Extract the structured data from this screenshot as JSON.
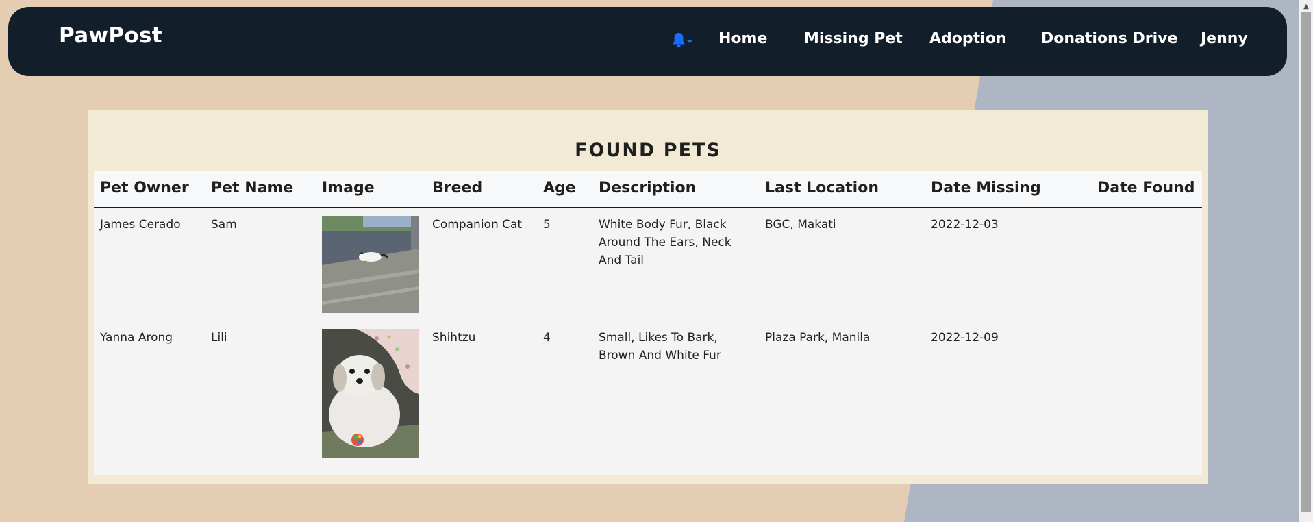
{
  "app": {
    "brand": "PawPost"
  },
  "nav": {
    "items": [
      "Home",
      "Missing Pet",
      "Adoption",
      "Donations Drive",
      "Jenny"
    ],
    "bell_icon": "bell-icon",
    "accent_color": "#1a6cff"
  },
  "page": {
    "title": "FOUND PETS"
  },
  "table": {
    "headers": [
      "Pet Owner",
      "Pet Name",
      "Image",
      "Breed",
      "Age",
      "Description",
      "Last Location",
      "Date Missing",
      "Date Found"
    ],
    "rows": [
      {
        "owner": "James Cerado",
        "pet_name": "Sam",
        "image": "cat-lying-on-pavement",
        "breed": "Companion Cat",
        "age": "5",
        "description": "White Body Fur, Black Around The Ears, Neck And Tail",
        "last_location": "BGC, Makati",
        "date_missing": "2022-12-03",
        "date_found": ""
      },
      {
        "owner": "Yanna Arong",
        "pet_name": "Lili",
        "image": "shihtzu-dog-sitting",
        "breed": "Shihtzu",
        "age": "4",
        "description": "Small, Likes To Bark, Brown And White Fur",
        "last_location": "Plaza Park, Manila",
        "date_missing": "2022-12-09",
        "date_found": ""
      }
    ]
  },
  "colors": {
    "navbar": "#121f2b",
    "card": "#f3ead6",
    "bg_tan": "#e4cdb2",
    "bg_blue": "#adb6c2"
  }
}
